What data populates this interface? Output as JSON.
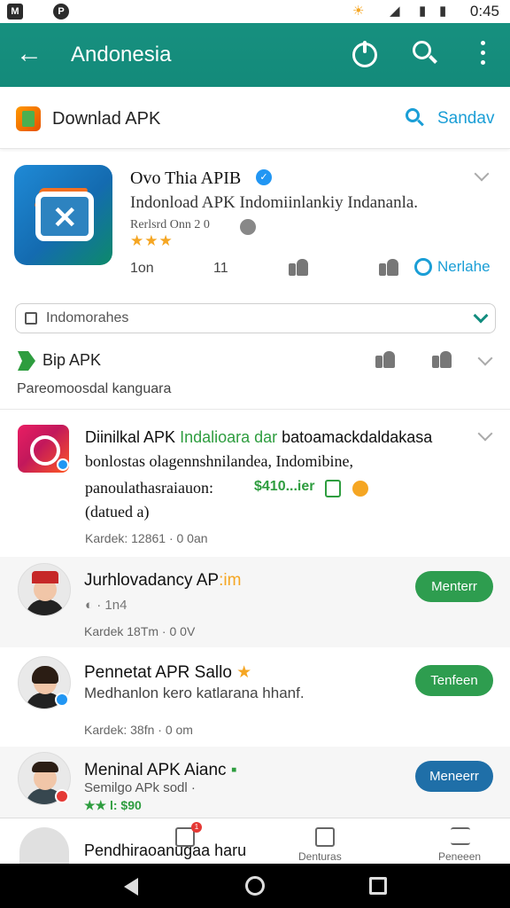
{
  "status_bar": {
    "time": "0:45",
    "left_icons": [
      "M",
      "P"
    ]
  },
  "app_bar": {
    "title": "Andonesia"
  },
  "header": {
    "title": "Downlad APK",
    "search_label": "Sandav"
  },
  "featured": {
    "name": "Ovo Thia APIB",
    "description": "Indonload APK Indomiinlankiy Indananla.",
    "meta": "Rerlsrd Onn 2 0",
    "stars": "★★★",
    "count_left": "1on",
    "count_mid": "11",
    "follow_label": "Nerlahe"
  },
  "filter": {
    "placeholder": "Indomorahes"
  },
  "section": {
    "title": "Bip APK",
    "subtitle": "Pareomoosdal kanguara"
  },
  "post": {
    "line1_prefix": "Diinilkal APK",
    "line1_green": "Indalioara dar",
    "line1_suffix": "batoamackdaldakasa",
    "line2": "bonlostas olagennshnilandea,  Indomibine,",
    "line3": "panoulathasraiauon:",
    "price": "$410...ier",
    "line4": "(datued a)",
    "meta": "Kardek: 12861 · 0 0an"
  },
  "users": [
    {
      "name": "Jurhlovadancy AP",
      "name_accent": ":im",
      "sub": "· 1n4",
      "meta": "Kardek 18Tm · 0 0V",
      "button": "Menterr",
      "button_color": "#2e9d4f"
    },
    {
      "name": "Pennetat APR Sallo",
      "name_accent": "★",
      "sub": "Medhanlon kero katlarana hhanf.",
      "meta": "Kardek: 38fn · 0 om",
      "button": "Tenfeen",
      "button_color": "#2e9d4f"
    },
    {
      "name": "Meninal APK Aianc",
      "name_accent": "▪",
      "sub": "Semilgo APk sodl ·",
      "meta": "★★ l: $90",
      "button": "Meneerr",
      "button_color": "#1f6fa8"
    }
  ],
  "bottom_nav": {
    "text": "Pendhiraoanugaa haru",
    "items": [
      {
        "label": "Denturas"
      },
      {
        "label": "Peneeen"
      }
    ],
    "badge": "1"
  },
  "colors": {
    "primary": "#17907f",
    "link": "#1a9ed6",
    "green": "#2e9d3f"
  }
}
